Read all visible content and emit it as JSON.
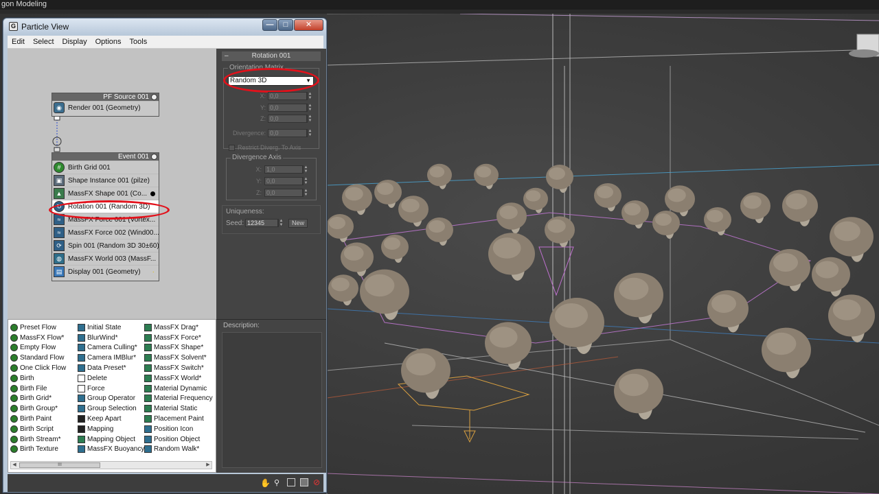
{
  "app": {
    "title": "gon Modeling"
  },
  "window": {
    "title": "Particle View",
    "icon_name": "max-icon",
    "buttons": {
      "minimize": "—",
      "maximize": "□",
      "close": "✕"
    }
  },
  "menu": [
    "Edit",
    "Select",
    "Display",
    "Options",
    "Tools"
  ],
  "pf_source": {
    "title": "PF Source 001",
    "operators": [
      {
        "label": "Render 001 (Geometry)",
        "icon": "render-icon"
      }
    ]
  },
  "event": {
    "title": "Event 001",
    "operators": [
      {
        "label": "Birth Grid 001",
        "icon": "birth-grid-icon"
      },
      {
        "label": "Shape Instance 001 (pilze)",
        "icon": "shape-instance-icon"
      },
      {
        "label": "MassFX Shape 001 (Co...",
        "icon": "massfx-shape-icon"
      },
      {
        "label": "Rotation 001 (Random 3D)",
        "icon": "rotation-icon"
      },
      {
        "label": "MassFX Force 001 (Vortex...",
        "icon": "massfx-force-icon"
      },
      {
        "label": "MassFX Force 002 (Wind00...",
        "icon": "massfx-force-icon"
      },
      {
        "label": "Spin 001 (Random 3D 30±60)",
        "icon": "spin-icon"
      },
      {
        "label": "MassFX World 003 (MassF...",
        "icon": "massfx-world-icon"
      },
      {
        "label": "Display 001 (Geometry)",
        "icon": "display-icon"
      }
    ]
  },
  "rollout": {
    "title": "Rotation 001",
    "orientation_matrix_label": "Orientation Matrix",
    "orientation_value": "Random 3D",
    "x_label": "X:",
    "x_value": "0,0",
    "y_label": "Y:",
    "y_value": "0,0",
    "z_label": "Z:",
    "z_value": "0,0",
    "divergence_label": "Divergence:",
    "divergence_value": "0,0",
    "restrict_label": "Restrict Diverg. To Axis",
    "axis_group_label": "Divergence Axis",
    "ax_label": "X:",
    "ax_value": "1,0",
    "ay_label": "Y:",
    "ay_value": "0,0",
    "az_label": "Z:",
    "az_value": "0,0",
    "uniqueness_label": "Uniqueness:",
    "seed_label": "Seed:",
    "seed_value": "12345",
    "new_button": "New"
  },
  "description_label": "Description:",
  "depot": {
    "col1": [
      "Preset Flow",
      "MassFX Flow*",
      "Empty Flow",
      "Standard Flow",
      "One Click Flow",
      "Birth",
      "Birth File",
      "Birth Grid*",
      "Birth Group*",
      "Birth Paint",
      "Birth Script",
      "Birth Stream*",
      "Birth Texture"
    ],
    "col2": [
      "Initial State",
      "BlurWind*",
      "Camera Culling*",
      "Camera IMBlur*",
      "Data Preset*",
      "Delete",
      "Force",
      "Group Operator",
      "Group Selection",
      "Keep Apart",
      "Mapping",
      "Mapping Object",
      "MassFX Buoyancy*"
    ],
    "col3": [
      "MassFX Drag*",
      "MassFX Force*",
      "MassFX Shape*",
      "MassFX Solvent*",
      "MassFX Switch*",
      "MassFX World*",
      "Material Dynamic",
      "Material Frequency",
      "Material Static",
      "Placement Paint",
      "Position Icon",
      "Position Object",
      "Random Walk*"
    ],
    "scroll_thumb": "III"
  },
  "status_icons": [
    "pan-hand-icon",
    "zoom-icon",
    "zoom-region-icon",
    "fit-icon",
    "no-icon"
  ],
  "colors": {
    "highlight": "#e2111b",
    "viewport": "#3a3a3a"
  }
}
